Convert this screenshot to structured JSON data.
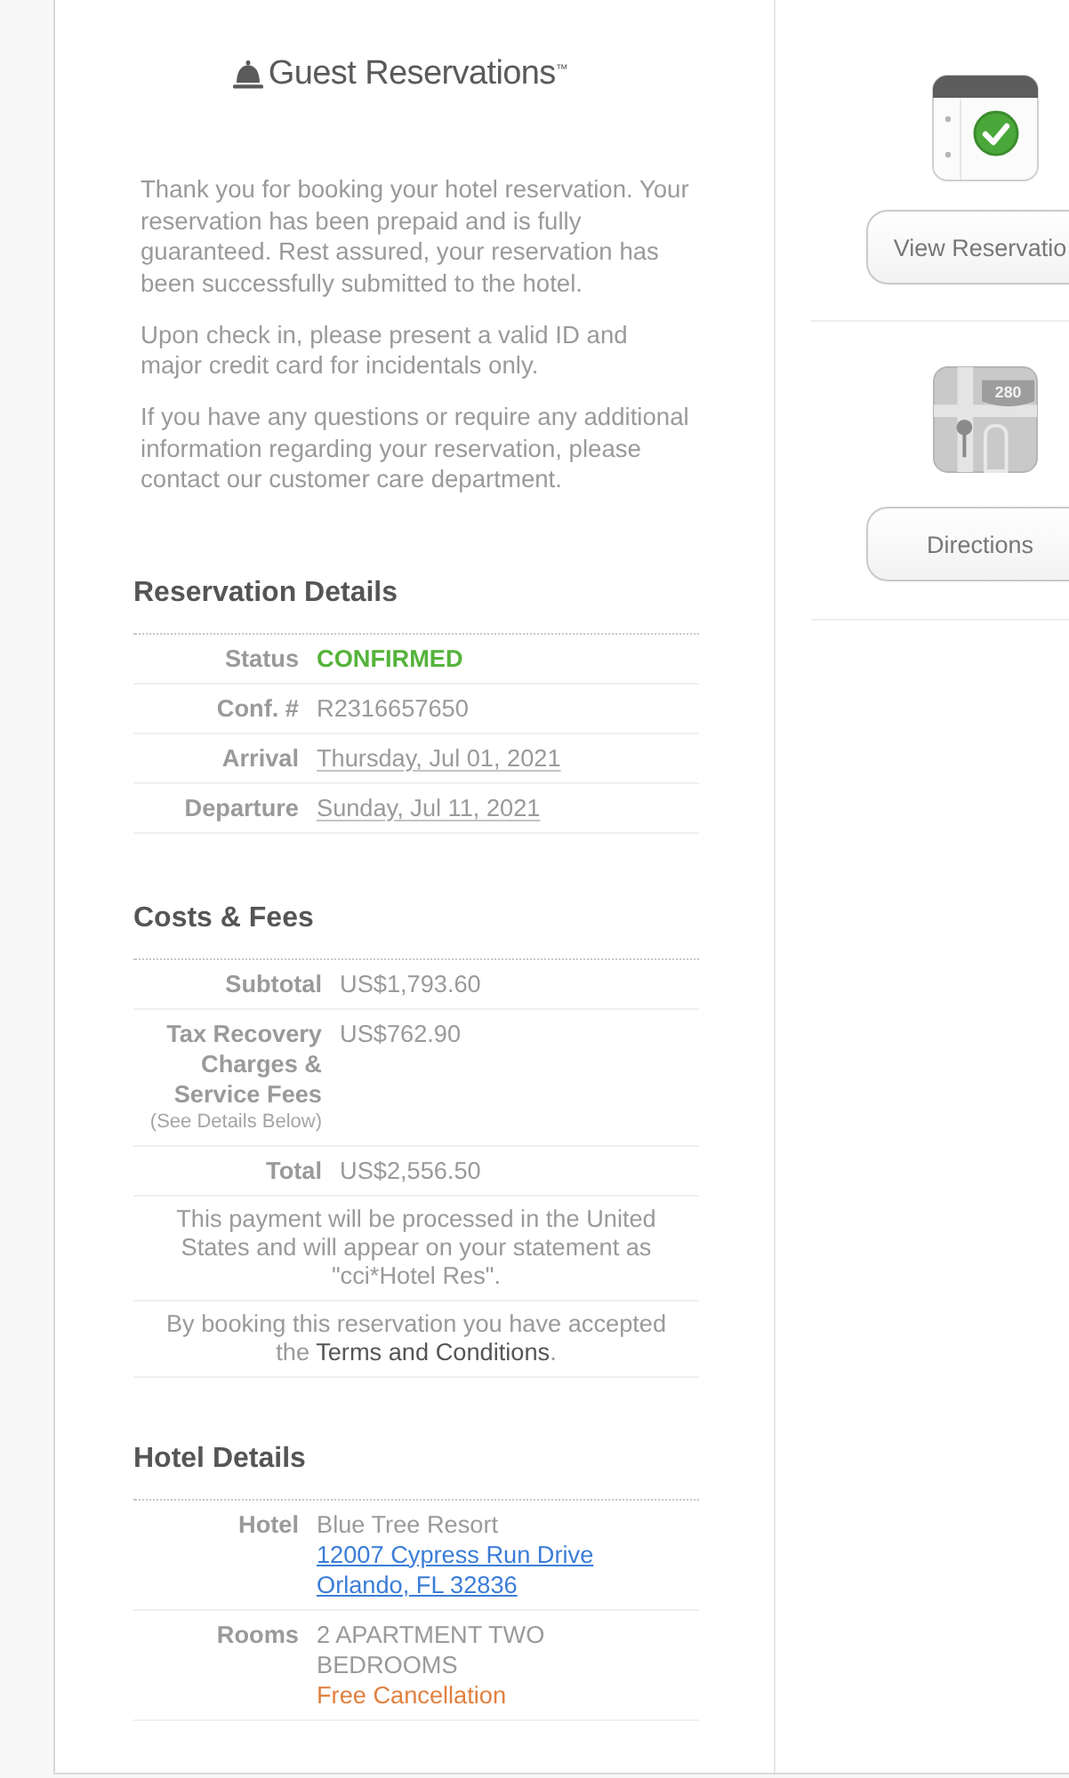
{
  "logo": {
    "text": "Guest Reservations$^{™}$"
  },
  "intro": [
    "Thank you for booking your hotel reservation. Your reservation has been prepaid and is fully guaranteed. Rest assured, your reservation has been successfully submitted to the hotel.",
    "Upon check in, please present a valid ID and major credit card for incidentals only.",
    "If you have any questions or require any additional information regarding your reservation, please contact our customer care department."
  ],
  "sections": [
    {
      "title": "Reservation Details",
      "rows": [
        {
          "label": "Status",
          "lines": [
            {
              "kind": "status",
              "text": "CONFIRMED"
            }
          ]
        },
        {
          "label": "Conf. #",
          "lines": [
            {
              "kind": "plain",
              "text": "R2316657650"
            }
          ]
        },
        {
          "label": "Arrival",
          "lines": [
            {
              "kind": "date",
              "text": "Thursday, Jul 01, 2021"
            }
          ]
        },
        {
          "label": "Departure",
          "lines": [
            {
              "kind": "date",
              "text": "Sunday, Jul 11, 2021"
            }
          ]
        }
      ]
    },
    {
      "title": "Costs & Fees",
      "rows": [
        {
          "label": "Subtotal",
          "lines": [
            {
              "kind": "plain",
              "text": "US$1,793.60"
            }
          ]
        },
        {
          "label": "Tax Recovery Charges & Service Fees",
          "note": "(See Details Below)",
          "lines": [
            {
              "kind": "plain",
              "text": "US$762.90"
            }
          ]
        },
        {
          "label": "Total",
          "lines": [
            {
              "kind": "plain",
              "text": "US$2,556.50"
            }
          ]
        }
      ],
      "notes": [
        {
          "text": "This payment will be processed in the United States and will appear on your statement as \"cci*Hotel Res\"."
        },
        {
          "text": "By booking this reservation you have accepted the",
          "link": "Terms and Conditions",
          "after": "."
        }
      ]
    },
    {
      "title": "Hotel Details",
      "rows": [
        {
          "label": "Hotel",
          "lines": [
            {
              "kind": "plain",
              "text": "Blue Tree Resort"
            },
            {
              "kind": "link",
              "text": "12007 Cypress Run Drive"
            },
            {
              "kind": "link",
              "text": "Orlando, FL 32836"
            }
          ]
        },
        {
          "label": "Rooms",
          "lines": [
            {
              "kind": "plain",
              "text": "2 APARTMENT TWO BEDROOMS"
            },
            {
              "kind": "offer",
              "text": "Free Cancellation"
            }
          ]
        }
      ]
    }
  ],
  "actions": [
    {
      "kind": "calendar",
      "label": "View Reservatio"
    },
    {
      "kind": "map",
      "label": "Directions",
      "badge": "280"
    }
  ]
}
